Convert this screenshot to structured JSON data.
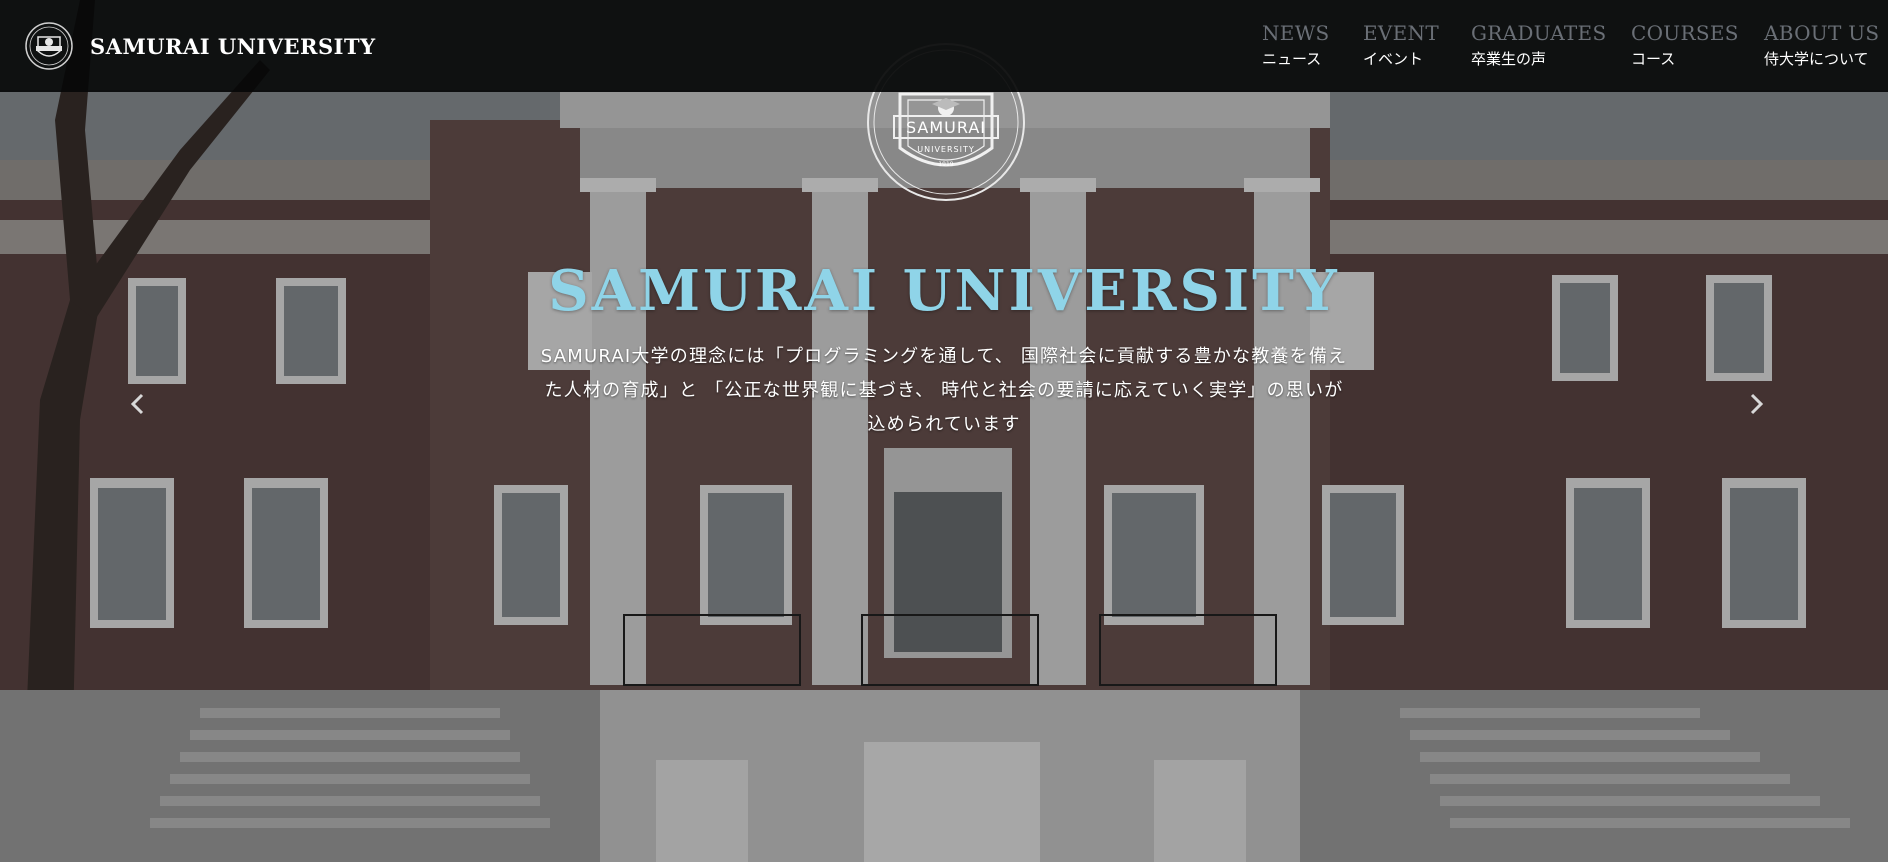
{
  "header": {
    "brand_name": "SAMURAI UNIVERSITY",
    "logo_icon": "university-crest-icon"
  },
  "nav": {
    "items": [
      {
        "en": "NEWS",
        "ja": "ニュース"
      },
      {
        "en": "EVENT",
        "ja": "イベント"
      },
      {
        "en": "GRADUATES",
        "ja": "卒業生の声"
      },
      {
        "en": "COURSES",
        "ja": "コース"
      },
      {
        "en": "ABOUT US",
        "ja": "侍大学について"
      }
    ]
  },
  "hero": {
    "emblem_text": "SAMURAI",
    "emblem_subtext": "UNIVERSITY",
    "emblem_year": "1919",
    "title": "SAMURAI UNIVERSITY",
    "description_lines": [
      "SAMURAI大学の理念には「プログラミングを通して、 国際社会に貢献する豊かな教養を備え",
      "た人材の育成」と 「公正な世界観に基づき、 時代と社会の要請に応えていく実学」の思いが",
      "込められています"
    ],
    "prev_icon": "chevron-left-icon",
    "next_icon": "chevron-right-icon"
  },
  "colors": {
    "title_accent": "#8fd4e8",
    "nav_english": "#6a6f76",
    "header_bg": "#060708"
  }
}
